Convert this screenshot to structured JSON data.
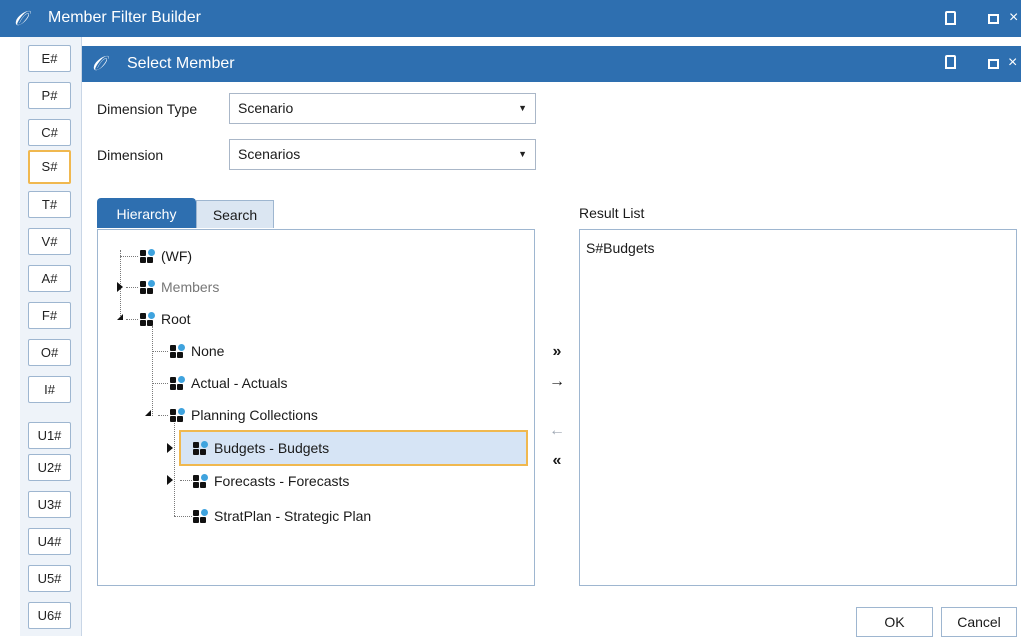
{
  "outer_window": {
    "title": "Member Filter Builder",
    "logo": "𝒪"
  },
  "dimension_buttons": [
    "E#",
    "P#",
    "C#",
    "S#",
    "T#",
    "V#",
    "A#",
    "F#",
    "O#",
    "I#",
    "U1#",
    "U2#",
    "U3#",
    "U4#",
    "U5#",
    "U6#"
  ],
  "selected_dimension": "S#",
  "dialog": {
    "title": "Select Member",
    "logo": "𝒪",
    "dimension_type_label": "Dimension Type",
    "dimension_type_value": "Scenario",
    "dimension_label": "Dimension",
    "dimension_value": "Scenarios",
    "tabs": [
      "Hierarchy",
      "Search"
    ],
    "active_tab": "Hierarchy",
    "result_list_label": "Result List",
    "result_items": [
      "S#Budgets"
    ],
    "tree": [
      {
        "label": "(WF)",
        "state": "leaf"
      },
      {
        "label": "Members",
        "state": "collapsed",
        "dim": true
      },
      {
        "label": "Root",
        "state": "expanded"
      },
      {
        "label": "None",
        "state": "leaf"
      },
      {
        "label": "Actual - Actuals",
        "state": "leaf"
      },
      {
        "label": "Planning Collections",
        "state": "expanded"
      },
      {
        "label": "Budgets - Budgets",
        "state": "collapsed",
        "selected": true
      },
      {
        "label": "Forecasts - Forecasts",
        "state": "collapsed"
      },
      {
        "label": "StratPlan - Strategic Plan",
        "state": "leaf"
      }
    ],
    "movers": {
      "add_all": "»",
      "add": "→",
      "remove": "←",
      "remove_all": "«"
    },
    "ok_label": "OK",
    "cancel_label": "Cancel"
  },
  "colors": {
    "titlebar": "#2e6fb0",
    "highlight": "#f0b84f",
    "selection": "#d6e4f5"
  },
  "icons": {
    "logo": "onestream-logo-icon",
    "restore": "restore-icon",
    "maximize": "maximize-icon",
    "close": "close-icon",
    "tree_node": "member-icon"
  }
}
